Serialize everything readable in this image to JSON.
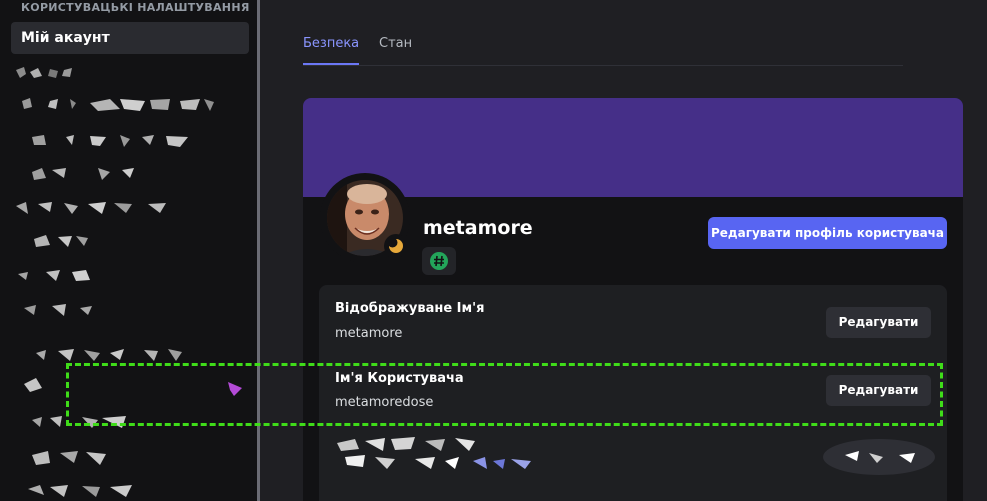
{
  "sidebar": {
    "section_header": "КОРИСТУВАЦЬКІ НАЛАШТУВАННЯ",
    "active_item": "Мій акаунт"
  },
  "tabs": [
    {
      "label": "Безпека",
      "active": true
    },
    {
      "label": "Стан",
      "active": false
    }
  ],
  "profile": {
    "display_username": "metamore",
    "edit_profile_label": "Редагувати профіль користувача",
    "badge_icon": "hashtag-icon",
    "status_icon": "moon-icon",
    "fields": [
      {
        "label": "Відображуване Ім'я",
        "value": "metamore",
        "button": "Редагувати"
      },
      {
        "label": "Ім'я Користувача",
        "value": "metamoredose",
        "button": "Редагувати"
      }
    ]
  },
  "colors": {
    "banner": "#452f88",
    "accent": "#5865f2",
    "highlight": "#3fdc19"
  }
}
